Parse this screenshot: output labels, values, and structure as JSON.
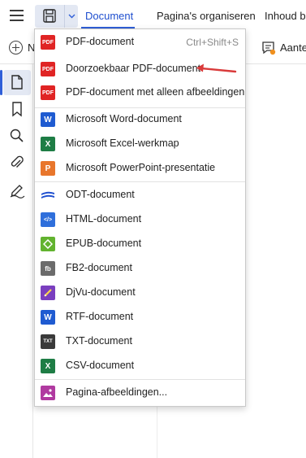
{
  "toolbar": {
    "tabs": [
      "Document",
      "Pagina's organiseren",
      "Inhoud be"
    ],
    "active_tab": "Document",
    "new_button_label": "N",
    "annotation_label": "Aante",
    "accent_color": "#2f5fd8"
  },
  "menu": {
    "items": [
      {
        "label": "PDF-document",
        "shortcut": "Ctrl+Shift+S",
        "icon": "pdf-icon",
        "badge": "PDF",
        "color": "#e02424"
      },
      {
        "label": "Doorzoekbaar PDF-document",
        "shortcut": "",
        "icon": "pdf-icon",
        "badge": "PDF",
        "color": "#e02424"
      },
      {
        "label": "PDF-document met alleen afbeeldingen",
        "shortcut": "",
        "icon": "pdf-icon",
        "badge": "PDF",
        "color": "#e02424"
      },
      {
        "label": "Microsoft Word-document",
        "shortcut": "",
        "icon": "word-icon",
        "badge": "W",
        "color": "#1f5bd1"
      },
      {
        "label": "Microsoft Excel-werkmap",
        "shortcut": "",
        "icon": "excel-icon",
        "badge": "X",
        "color": "#1e7d45"
      },
      {
        "label": "Microsoft PowerPoint-presentatie",
        "shortcut": "",
        "icon": "powerpoint-icon",
        "badge": "P",
        "color": "#e8762c"
      },
      {
        "label": "ODT-document",
        "shortcut": "",
        "icon": "odt-icon",
        "badge": "",
        "color": "#1f4fcf"
      },
      {
        "label": "HTML-document",
        "shortcut": "",
        "icon": "html-icon",
        "badge": "</>",
        "color": "#2f6fdb"
      },
      {
        "label": "EPUB-document",
        "shortcut": "",
        "icon": "epub-icon",
        "badge": "",
        "color": "#62b32f"
      },
      {
        "label": "FB2-document",
        "shortcut": "",
        "icon": "fb2-icon",
        "badge": "fb",
        "color": "#6b6b6b"
      },
      {
        "label": "DjVu-document",
        "shortcut": "",
        "icon": "djvu-icon",
        "badge": "",
        "color": "#7a3fbf"
      },
      {
        "label": "RTF-document",
        "shortcut": "",
        "icon": "rtf-icon",
        "badge": "W",
        "color": "#1f5bd1"
      },
      {
        "label": "TXT-document",
        "shortcut": "",
        "icon": "txt-icon",
        "badge": "TXT",
        "color": "#3a3a3a"
      },
      {
        "label": "CSV-document",
        "shortcut": "",
        "icon": "csv-icon",
        "badge": "X",
        "color": "#1e7d45"
      },
      {
        "label": "Pagina-afbeeldingen...",
        "shortcut": "",
        "icon": "image-icon",
        "badge": "",
        "color": "#b03aa0"
      }
    ]
  },
  "annotation_arrow_color": "#d93a3a"
}
